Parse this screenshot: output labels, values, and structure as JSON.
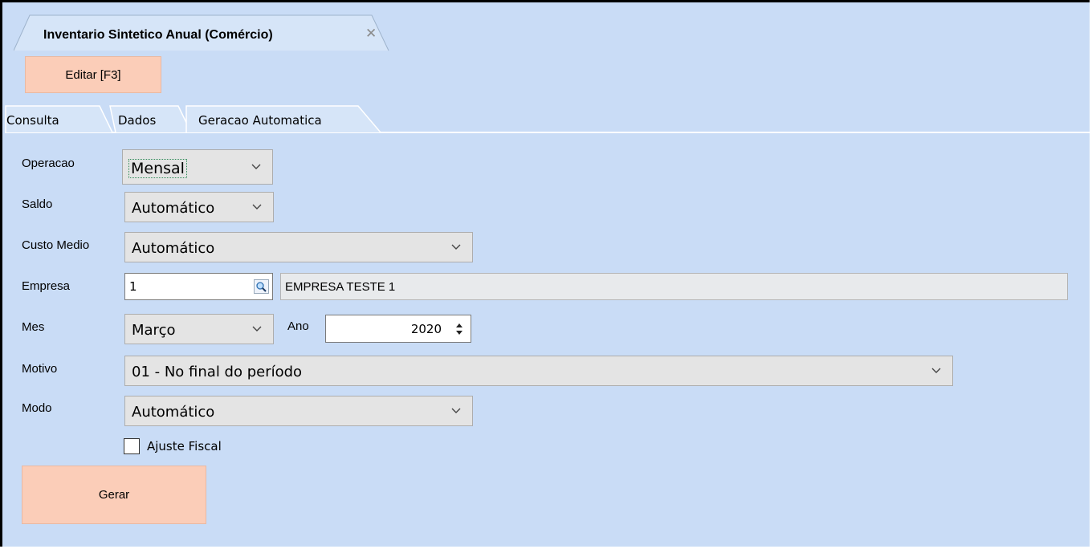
{
  "document_tab": {
    "title": "Inventario Sintetico Anual (Comércio)",
    "close": "✕"
  },
  "toolbar": {
    "edit_label": "Editar [F3]"
  },
  "tabs": [
    {
      "label": "Consulta"
    },
    {
      "label": "Dados"
    },
    {
      "label": "Geracao Automatica"
    }
  ],
  "form": {
    "operacao": {
      "label": "Operacao",
      "value": "Mensal"
    },
    "saldo": {
      "label": "Saldo",
      "value": "Automático"
    },
    "custo_medio": {
      "label": "Custo Medio",
      "value": "Automático"
    },
    "empresa": {
      "label": "Empresa",
      "code": "1",
      "name": "EMPRESA TESTE 1"
    },
    "mes": {
      "label": "Mes",
      "value": "Março"
    },
    "ano": {
      "label": "Ano",
      "value": "2020"
    },
    "motivo": {
      "label": "Motivo",
      "value": "01 - No final do período"
    },
    "modo": {
      "label": "Modo",
      "value": "Automático"
    },
    "ajuste_fiscal": {
      "label": "Ajuste Fiscal",
      "checked": false
    }
  },
  "actions": {
    "generate_label": "Gerar"
  },
  "icons": {
    "lookup": "search-icon",
    "chevron": "chevron-down-icon",
    "spinner": "spin-arrows-icon"
  },
  "colors": {
    "background": "#c9dcf6",
    "button": "#fbcdb8",
    "focus_border": "#2e8b57"
  }
}
